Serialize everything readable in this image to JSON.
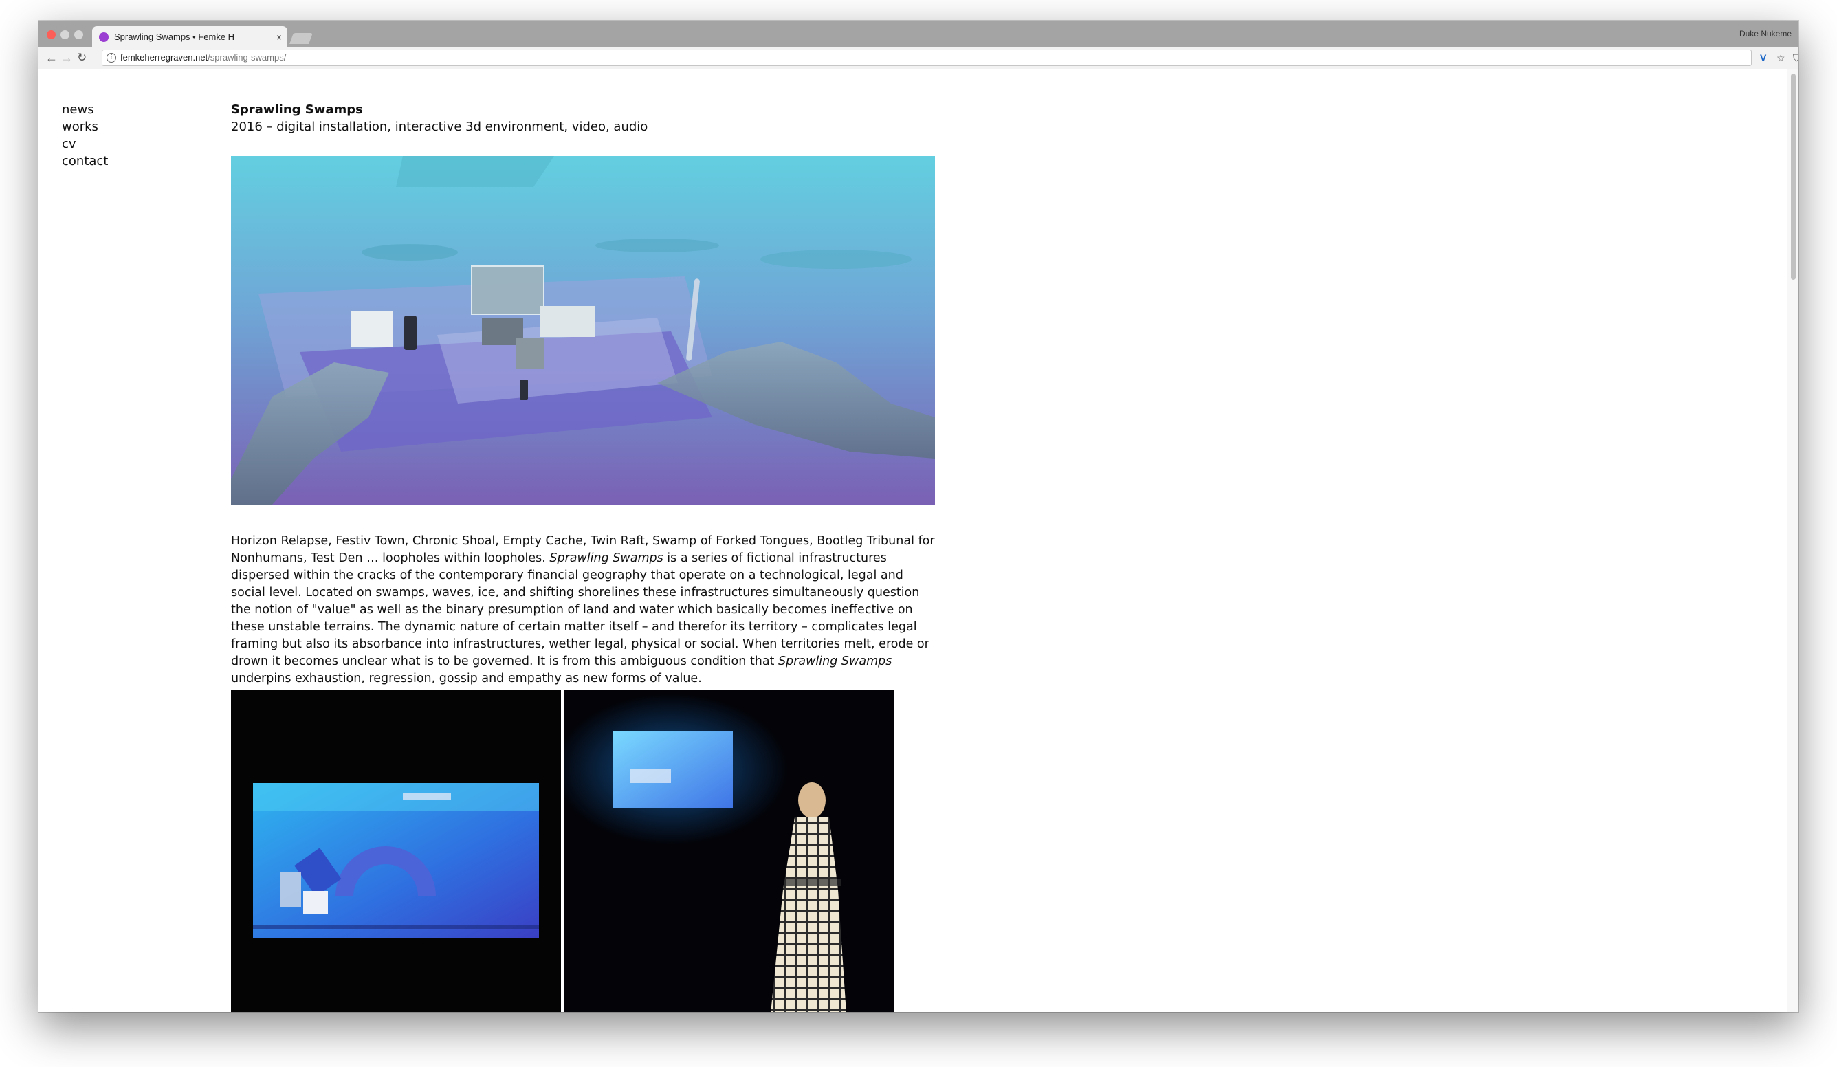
{
  "browser": {
    "tab_title": "Sprawling Swamps • Femke H",
    "tab_close": "×",
    "profile_name": "Duke Nukeme",
    "url_host": "femkeherregraven.net",
    "url_path": "/sprawling-swamps/",
    "nav_back": "←",
    "nav_forward": "→",
    "nav_reload": "↻",
    "info_glyph": "i",
    "ext_v": "V",
    "bookmark_star": "☆",
    "ext_shield": "⛉",
    "menu_dots": "⋮"
  },
  "nav": {
    "items": [
      "news",
      "works",
      "cv",
      "contact"
    ]
  },
  "work": {
    "title": "Sprawling Swamps",
    "subtitle": "2016 – digital installation, interactive 3d environment, video, audio",
    "description": {
      "part1": "Horizon Relapse, Festiv Town, Chronic Shoal, Empty Cache, Twin Raft, Swamp of Forked Tongues, Bootleg Tribunal for Nonhumans, Test Den … loopholes within loopholes. ",
      "italic1": "Sprawling Swamps",
      "part2": " is a series of fictional infrastructures dispersed within the cracks of the contemporary financial geography that operate on a technological, legal and social level. Located on swamps, waves, ice, and shifting shorelines these infrastructures simultaneously question the notion of \"value\" as well as the binary presumption of land and water which basically becomes ineffective on these unstable terrains. The dynamic nature of certain matter itself – and therefor its territory – complicates legal framing but also its absorbance into infrastructures, wether legal, physical or social. When territories melt, erode or drown it becomes unclear what is to be governed. It is from this ambiguous condition that ",
      "italic2": "Sprawling Swamps",
      "part3": " underpins exhaustion, regression, gossip and empathy as new forms of value."
    }
  },
  "colors": {
    "page_bg": "#ffffff",
    "text": "#111111",
    "hero_sky": "#5ad6e2",
    "hero_water": "#7d63b4",
    "photo_bg": "#040404",
    "screen_glow": "#1e90ff"
  }
}
